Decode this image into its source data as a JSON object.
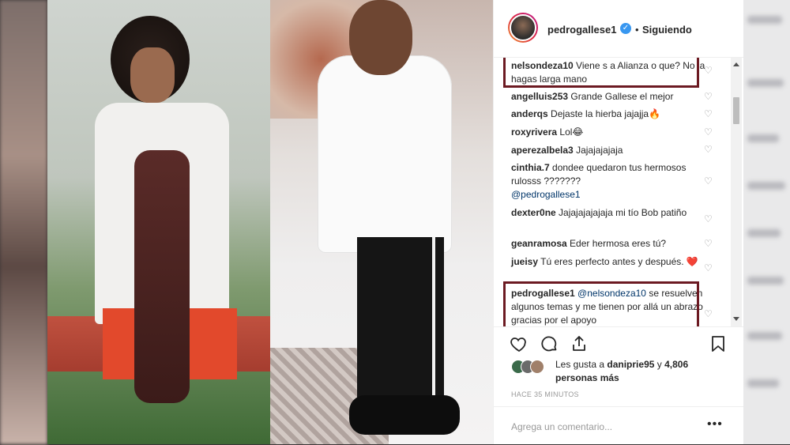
{
  "post": {
    "username": "pedrogallese1",
    "verified_icon": "verified-check-icon",
    "separator": "•",
    "follow_state": "Siguiendo"
  },
  "comments": [
    {
      "user": "nelsondeza10",
      "text": "Viene s a Alianza o que? No la hagas larga mano",
      "highlighted": true
    },
    {
      "user": "angelluis253",
      "text": "Grande Gallese el mejor"
    },
    {
      "user": "anderqs",
      "text": "Dejaste la hierba jajajja🔥"
    },
    {
      "user": "roxyrivera",
      "text": "Lol😂"
    },
    {
      "user": "aperezalbela3",
      "text": "Jajajajajaja"
    },
    {
      "user": "cinthia.7",
      "text": "dondee quedaron tus hermosos rulosss ???????",
      "mention": "@pedrogallese1"
    },
    {
      "user": "dexter0ne",
      "text": "Jajajajajajaja mi tío Bob patiño"
    },
    {
      "user": "geanramosa",
      "text": "Eder hermosa eres tú?"
    },
    {
      "user": "jueisy",
      "text": "Tú eres perfecto antes y después. ❤️"
    },
    {
      "user": "pedrogallese1",
      "mention": "@nelsondeza10",
      "text": "se resuelven algunos temas y me tienen por allá un abrazo gracias por el apoyo",
      "highlighted": true
    }
  ],
  "likes": {
    "prefix": "Les gusta a",
    "user": "daniprie95",
    "connector": "y",
    "count_text": "4,806 personas más"
  },
  "timestamp": "HACE 35 MINUTOS",
  "add_comment_placeholder": "Agrega un comentario...",
  "more_options": "•••",
  "colors": {
    "highlight_border": "#6c1a22",
    "verified": "#3897f0",
    "text": "#262626",
    "muted": "#999999"
  }
}
